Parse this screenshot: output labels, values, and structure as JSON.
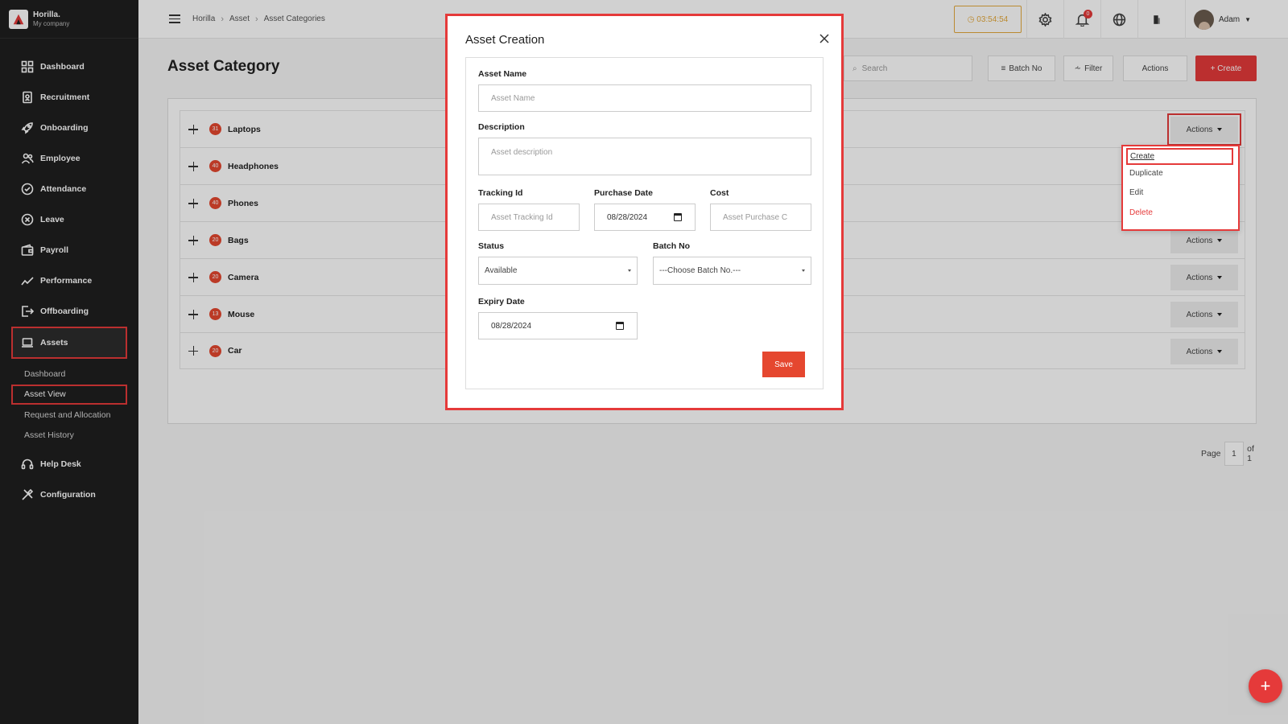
{
  "brand": {
    "name": "Horilla.",
    "company": "My company"
  },
  "sidebar": {
    "items": [
      {
        "label": "Dashboard",
        "icon": "dashboard-icon"
      },
      {
        "label": "Recruitment",
        "icon": "recruitment-icon"
      },
      {
        "label": "Onboarding",
        "icon": "rocket-icon"
      },
      {
        "label": "Employee",
        "icon": "users-icon"
      },
      {
        "label": "Attendance",
        "icon": "check-circle-icon"
      },
      {
        "label": "Leave",
        "icon": "x-circle-icon"
      },
      {
        "label": "Payroll",
        "icon": "wallet-icon"
      },
      {
        "label": "Performance",
        "icon": "chart-line-icon"
      },
      {
        "label": "Offboarding",
        "icon": "exit-icon"
      },
      {
        "label": "Assets",
        "icon": "laptop-icon"
      }
    ],
    "assets_sub": [
      "Dashboard",
      "Asset View",
      "Request and Allocation",
      "Asset History"
    ],
    "after": [
      {
        "label": "Help Desk",
        "icon": "headset-icon"
      },
      {
        "label": "Configuration",
        "icon": "tools-icon"
      }
    ]
  },
  "topbar": {
    "breadcrumb": [
      "Horilla",
      "Asset",
      "Asset Categories"
    ],
    "timer": "03:54:54",
    "notification_count": "0",
    "user_name": "Adam"
  },
  "page": {
    "title": "Asset Category",
    "search_placeholder": "Search",
    "batch_btn": "Batch No",
    "filter_btn": "Filter",
    "actions_btn": "Actions",
    "create_btn": "+ Create"
  },
  "categories": [
    {
      "count": "31",
      "name": "Laptops",
      "actions": "Actions"
    },
    {
      "count": "40",
      "name": "Headphones",
      "actions": "Actions"
    },
    {
      "count": "40",
      "name": "Phones",
      "actions": "Actions"
    },
    {
      "count": "20",
      "name": "Bags",
      "actions": "Actions"
    },
    {
      "count": "20",
      "name": "Camera",
      "actions": "Actions"
    },
    {
      "count": "13",
      "name": "Mouse",
      "actions": "Actions"
    },
    {
      "count": "20",
      "name": "Car",
      "actions": "Actions"
    }
  ],
  "pager": {
    "label": "Page",
    "current": "1",
    "total": "of 1"
  },
  "dropdown": {
    "items": [
      "Create",
      "Duplicate",
      "Edit",
      "Delete"
    ]
  },
  "modal": {
    "title": "Asset Creation",
    "asset_name_label": "Asset Name",
    "asset_name_placeholder": "Asset Name",
    "description_label": "Description",
    "description_placeholder": "Asset description",
    "tracking_label": "Tracking Id",
    "tracking_placeholder": "Asset Tracking Id",
    "purchase_date_label": "Purchase Date",
    "purchase_date_value": "08/28/2024",
    "cost_label": "Cost",
    "cost_placeholder": "Asset Purchase C",
    "status_label": "Status",
    "status_value": "Available",
    "batch_label": "Batch No",
    "batch_value": "---Choose Batch No.---",
    "expiry_label": "Expiry Date",
    "expiry_value": "08/28/2024",
    "save": "Save"
  },
  "colors": {
    "accent": "#e53a3a",
    "sidebar": "#1f1f1f",
    "timer": "#e4a93c"
  }
}
